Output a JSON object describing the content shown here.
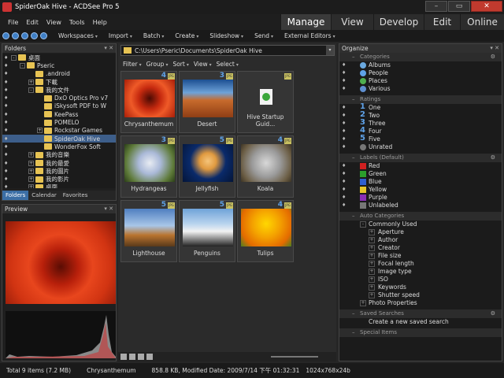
{
  "window": {
    "title": "SpiderOak Hive - ACDSee Pro 5"
  },
  "menu": [
    "File",
    "Edit",
    "View",
    "Tools",
    "Help"
  ],
  "modes": [
    {
      "label": "Manage",
      "active": true
    },
    {
      "label": "View",
      "active": false
    },
    {
      "label": "Develop",
      "active": false
    },
    {
      "label": "Edit",
      "active": false
    },
    {
      "label": "Online",
      "active": false
    }
  ],
  "toolbar": [
    "Workspaces",
    "Import",
    "Batch",
    "Create",
    "Slideshow",
    "Send",
    "External Editors"
  ],
  "folders": {
    "header": "Folders",
    "tree": [
      {
        "label": "桌面",
        "depth": 0,
        "exp": "-"
      },
      {
        "label": "Pseric",
        "depth": 1,
        "exp": "-"
      },
      {
        "label": ".android",
        "depth": 2,
        "exp": ""
      },
      {
        "label": "下載",
        "depth": 2,
        "exp": "+"
      },
      {
        "label": "我的文件",
        "depth": 2,
        "exp": "-"
      },
      {
        "label": "DxO Optics Pro v7",
        "depth": 3,
        "exp": ""
      },
      {
        "label": "iSkysoft PDF to W",
        "depth": 3,
        "exp": ""
      },
      {
        "label": "KeePass",
        "depth": 3,
        "exp": ""
      },
      {
        "label": "POMELO",
        "depth": 3,
        "exp": ""
      },
      {
        "label": "Rockstar Games",
        "depth": 3,
        "exp": "+"
      },
      {
        "label": "SpiderOak Hive",
        "depth": 3,
        "exp": "",
        "sel": true
      },
      {
        "label": "WonderFox Soft",
        "depth": 3,
        "exp": ""
      },
      {
        "label": "我的音樂",
        "depth": 2,
        "exp": "+"
      },
      {
        "label": "我的最愛",
        "depth": 2,
        "exp": "+"
      },
      {
        "label": "我的圖片",
        "depth": 2,
        "exp": "+"
      },
      {
        "label": "我的影片",
        "depth": 2,
        "exp": "+"
      },
      {
        "label": "桌面",
        "depth": 2,
        "exp": "+"
      }
    ],
    "tabs": [
      "Folders",
      "Calendar",
      "Favorites"
    ]
  },
  "preview": {
    "header": "Preview"
  },
  "path": "C:\\Users\\Pseric\\Documents\\SpiderOak Hive",
  "subtoolbar": [
    "Filter",
    "Group",
    "Sort",
    "View",
    "Select"
  ],
  "thumbnails": [
    {
      "name": "Chrysanthemum",
      "num": "4",
      "kind": "flower"
    },
    {
      "name": "Desert",
      "num": "3",
      "kind": "desert"
    },
    {
      "name": "Hive Startup Guid...",
      "num": "",
      "kind": "doc"
    },
    {
      "name": "Hydrangeas",
      "num": "3",
      "kind": "hydrangea"
    },
    {
      "name": "Jellyfish",
      "num": "5",
      "kind": "jelly"
    },
    {
      "name": "Koala",
      "num": "4",
      "kind": "koala"
    },
    {
      "name": "Lighthouse",
      "num": "5",
      "kind": "lighthouse"
    },
    {
      "name": "Penguins",
      "num": "5",
      "kind": "penguin"
    },
    {
      "name": "Tulips",
      "num": "4",
      "kind": "tulip"
    }
  ],
  "organize": {
    "header": "Organize",
    "categories_label": "Categories",
    "categories": [
      {
        "label": "Albums",
        "color": "#6aa9e0"
      },
      {
        "label": "People",
        "color": "#5fa2e8"
      },
      {
        "label": "Places",
        "color": "#4fae4f"
      },
      {
        "label": "Various",
        "color": "#5f8fd0"
      }
    ],
    "ratings_label": "Ratings",
    "ratings": [
      {
        "num": "1",
        "label": "One"
      },
      {
        "num": "2",
        "label": "Two"
      },
      {
        "num": "3",
        "label": "Three"
      },
      {
        "num": "4",
        "label": "Four"
      },
      {
        "num": "5",
        "label": "Five"
      },
      {
        "num": "",
        "label": "Unrated"
      }
    ],
    "labels_label": "Labels (Default)",
    "labels": [
      {
        "label": "Red",
        "color": "#d02020"
      },
      {
        "label": "Green",
        "color": "#2ca02c"
      },
      {
        "label": "Blue",
        "color": "#2f5fd0"
      },
      {
        "label": "Yellow",
        "color": "#e6c62a"
      },
      {
        "label": "Purple",
        "color": "#8a2fb5"
      },
      {
        "label": "Unlabeled",
        "color": "#777777"
      }
    ],
    "auto_label": "Auto Categories",
    "auto": [
      {
        "label": "Commonly Used",
        "lvl": 0
      },
      {
        "label": "Aperture",
        "lvl": 1
      },
      {
        "label": "Author",
        "lvl": 1
      },
      {
        "label": "Creator",
        "lvl": 1
      },
      {
        "label": "File size",
        "lvl": 1
      },
      {
        "label": "Focal length",
        "lvl": 1
      },
      {
        "label": "Image type",
        "lvl": 1
      },
      {
        "label": "ISO",
        "lvl": 1
      },
      {
        "label": "Keywords",
        "lvl": 1
      },
      {
        "label": "Shutter speed",
        "lvl": 1
      },
      {
        "label": "Photo Properties",
        "lvl": 0
      }
    ],
    "saved_label": "Saved Searches",
    "saved_action": "Create a new saved search",
    "special_label": "Special Items"
  },
  "status": {
    "total": "Total 9 items  (7.2 MB)",
    "file": "Chrysanthemum",
    "info": "858.8 KB, Modified Date: 2009/7/14 下午 01:32:31",
    "dims": "1024x768x24b"
  }
}
